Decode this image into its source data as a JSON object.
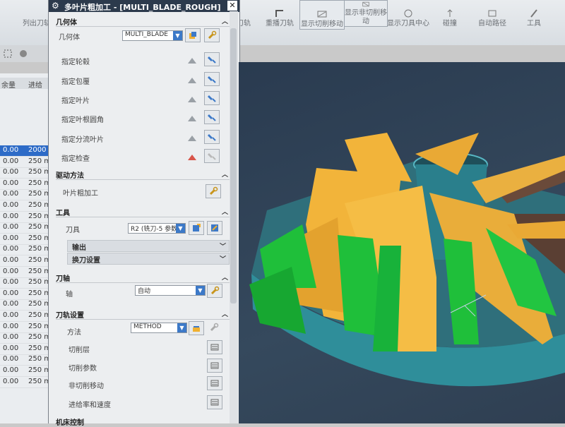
{
  "ribbon": {
    "items": [
      {
        "label": "列出刀轨"
      },
      {
        "label": "刀轨"
      },
      {
        "label": "重播刀轨"
      },
      {
        "label": "显示切削移动"
      },
      {
        "label": "显示非切削移动"
      },
      {
        "label": "显示刀具中心"
      },
      {
        "label": "碰撞"
      },
      {
        "label": "自动路径"
      },
      {
        "label": "工具"
      }
    ]
  },
  "left_list": {
    "headers": [
      "余量",
      "进给"
    ],
    "rows": [
      {
        "a": "0.00",
        "b": "2000 mm"
      },
      {
        "a": "0.00",
        "b": "250 mm"
      },
      {
        "a": "0.00",
        "b": "250 mm"
      },
      {
        "a": "0.00",
        "b": "250 mm"
      },
      {
        "a": "0.00",
        "b": "250 mm"
      },
      {
        "a": "0.00",
        "b": "250 mm"
      },
      {
        "a": "0.00",
        "b": "250 mm"
      },
      {
        "a": "0.00",
        "b": "250 mm"
      },
      {
        "a": "0.00",
        "b": "250 mm"
      },
      {
        "a": "0.00",
        "b": "250 mm"
      },
      {
        "a": "0.00",
        "b": "250 mm"
      },
      {
        "a": "0.00",
        "b": "250 mm"
      },
      {
        "a": "0.00",
        "b": "250 mm"
      },
      {
        "a": "0.00",
        "b": "250 mm"
      },
      {
        "a": "0.00",
        "b": "250 mm"
      },
      {
        "a": "0.00",
        "b": "250 mm"
      },
      {
        "a": "0.00",
        "b": "250 mm"
      },
      {
        "a": "0.00",
        "b": "250 mm"
      },
      {
        "a": "0.00",
        "b": "250 mm"
      },
      {
        "a": "0.00",
        "b": "250 mm"
      },
      {
        "a": "0.00",
        "b": "250 mm"
      },
      {
        "a": "0.00",
        "b": "250 mm"
      }
    ]
  },
  "dialog": {
    "title": "多叶片粗加工 - [MULTI_BLADE_ROUGH]",
    "close": "✕",
    "geometry": {
      "section": "几何体",
      "geometry_label": "几何体",
      "geometry_value": "MULTI_BLADE",
      "rows": [
        "指定轮毂",
        "指定包覆",
        "指定叶片",
        "指定叶根圆角",
        "指定分流叶片",
        "指定检查"
      ]
    },
    "drive": {
      "section": "驱动方法",
      "method_label": "叶片粗加工"
    },
    "tool": {
      "section": "工具",
      "tool_label": "刀具",
      "tool_value": "R2 (铣刀-5 参数)",
      "output": "输出",
      "change": "换刀设置"
    },
    "axis": {
      "section": "刀轴",
      "axis_label": "轴",
      "axis_value": "自动"
    },
    "path": {
      "section": "刀轨设置",
      "method_label": "方法",
      "method_value": "METHOD",
      "rows": [
        "切削层",
        "切削参数",
        "非切削移动",
        "进给率和速度"
      ]
    },
    "machine": {
      "section": "机床控制"
    }
  },
  "colors": {
    "blade_yellow": "#f2b43a",
    "blade_green": "#1fbf3a",
    "hub_teal": "#2f8e9a",
    "background": "#2f4257"
  }
}
